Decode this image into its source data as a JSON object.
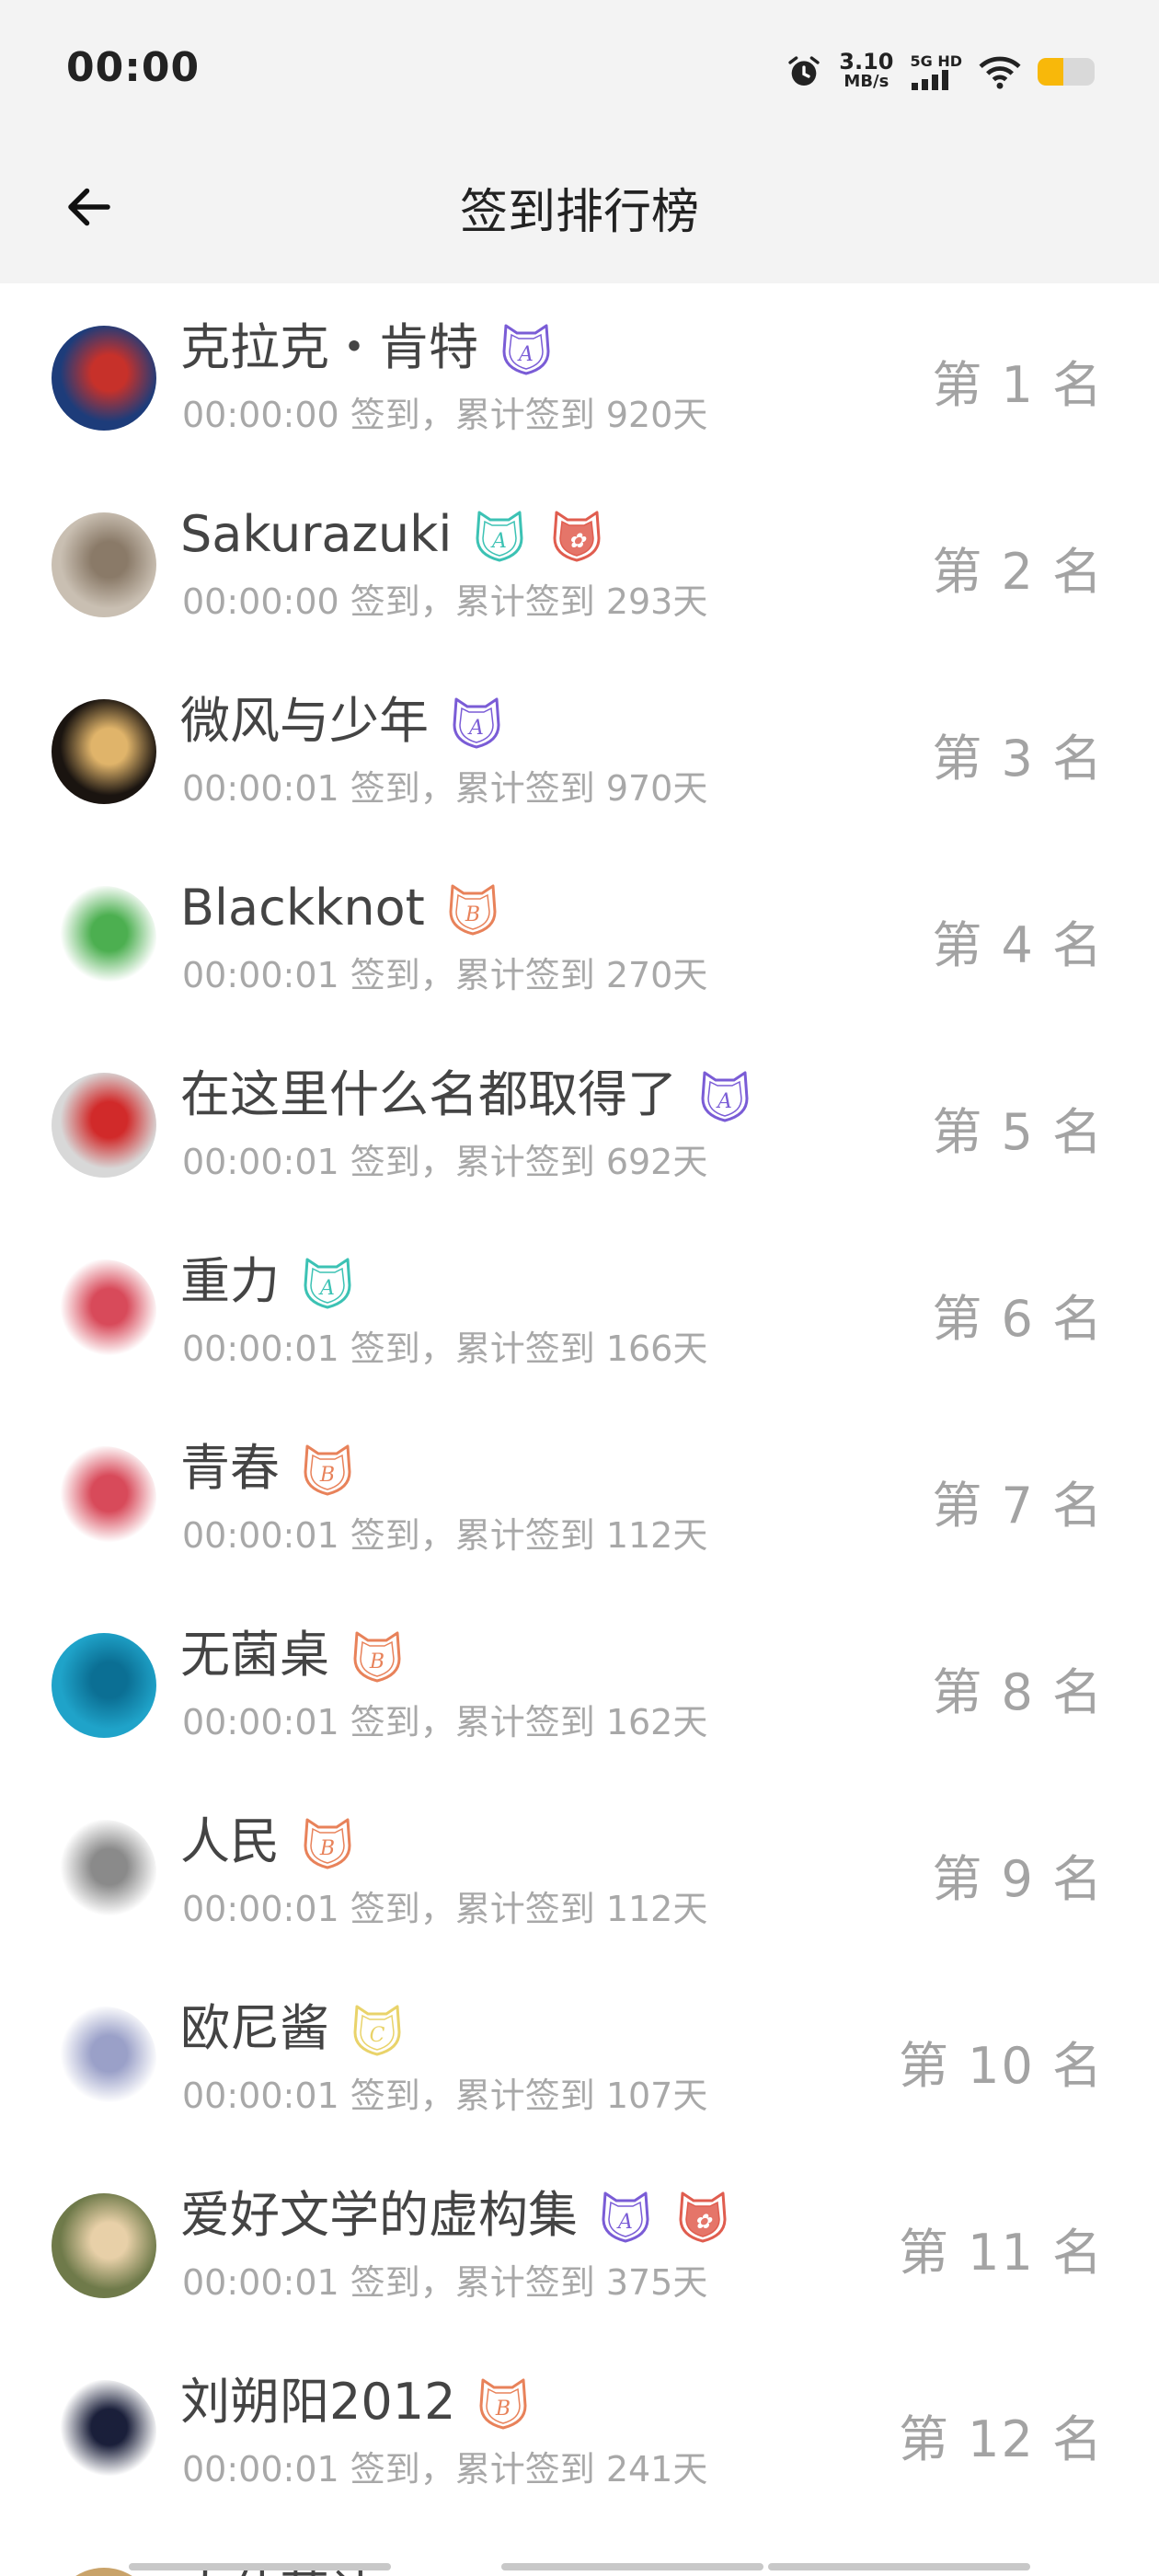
{
  "status_bar": {
    "time": "00:00",
    "speed_value": "3.10",
    "speed_unit": "MB/s",
    "network_top": "5G HD",
    "battery_level": 0.45,
    "battery_color": "#f8b80a"
  },
  "header": {
    "title": "签到排行榜"
  },
  "ranking": [
    {
      "name": "克拉克・肯特",
      "time": "00:00:00",
      "days": "920",
      "rank": "第 1 名",
      "avatar_colors": [
        "#1d3c7a",
        "#c7312a"
      ],
      "badges": [
        {
          "icon": "badge-a-purple",
          "color": "#7a5cd6",
          "letter": "A"
        }
      ]
    },
    {
      "name": "Sakurazuki",
      "time": "00:00:00",
      "days": "293",
      "rank": "第 2 名",
      "avatar_colors": [
        "#c9bfb2",
        "#8a7a68"
      ],
      "badges": [
        {
          "icon": "badge-a-teal",
          "color": "#3cc2b4",
          "letter": "A"
        },
        {
          "icon": "badge-special-red",
          "color": "#e05d4f",
          "letter": "✿"
        }
      ]
    },
    {
      "name": "微风与少年",
      "time": "00:00:01",
      "days": "970",
      "rank": "第 3 名",
      "avatar_colors": [
        "#1a1410",
        "#e0b46a"
      ],
      "badges": [
        {
          "icon": "badge-a-purple",
          "color": "#7a5cd6",
          "letter": "A"
        }
      ]
    },
    {
      "name": "Blackknot",
      "time": "00:00:01",
      "days": "270",
      "rank": "第 4 名",
      "avatar_colors": [
        "#ffffff",
        "#4caf50"
      ],
      "badges": [
        {
          "icon": "badge-b-orange",
          "color": "#e8825a",
          "letter": "B"
        }
      ]
    },
    {
      "name": "在这里什么名都取得了",
      "time": "00:00:01",
      "days": "692",
      "rank": "第 5 名",
      "avatar_colors": [
        "#d8d8d8",
        "#d12a2a"
      ],
      "badges": [
        {
          "icon": "badge-a-purple",
          "color": "#7a5cd6",
          "letter": "A"
        }
      ]
    },
    {
      "name": "重力",
      "time": "00:00:01",
      "days": "166",
      "rank": "第 6 名",
      "avatar_colors": [
        "#ffffff",
        "#d84a5a"
      ],
      "badges": [
        {
          "icon": "badge-a-teal",
          "color": "#3cc2b4",
          "letter": "A"
        }
      ]
    },
    {
      "name": "青春",
      "time": "00:00:01",
      "days": "112",
      "rank": "第 7 名",
      "avatar_colors": [
        "#ffffff",
        "#d84a5a"
      ],
      "badges": [
        {
          "icon": "badge-b-orange",
          "color": "#e8825a",
          "letter": "B"
        }
      ]
    },
    {
      "name": "无菌桌",
      "time": "00:00:01",
      "days": "162",
      "rank": "第 8 名",
      "avatar_colors": [
        "#1fa3c9",
        "#0b6f94"
      ],
      "badges": [
        {
          "icon": "badge-b-orange",
          "color": "#e8825a",
          "letter": "B"
        }
      ]
    },
    {
      "name": "人民",
      "time": "00:00:01",
      "days": "112",
      "rank": "第 9 名",
      "avatar_colors": [
        "#ffffff",
        "#8a8a8a"
      ],
      "badges": [
        {
          "icon": "badge-b-orange",
          "color": "#e8825a",
          "letter": "B"
        }
      ]
    },
    {
      "name": "欧尼酱",
      "time": "00:00:01",
      "days": "107",
      "rank": "第 10 名",
      "avatar_colors": [
        "#ffffff",
        "#9aa0c8"
      ],
      "badges": [
        {
          "icon": "badge-c-yellow",
          "color": "#e9d36a",
          "letter": "C"
        }
      ]
    },
    {
      "name": "爱好文学的虚构集",
      "time": "00:00:01",
      "days": "375",
      "rank": "第 11 名",
      "avatar_colors": [
        "#6f7a4a",
        "#e8d0a8"
      ],
      "badges": [
        {
          "icon": "badge-a-purple",
          "color": "#7a5cd6",
          "letter": "A"
        },
        {
          "icon": "badge-special-red",
          "color": "#e05d4f",
          "letter": "✿"
        }
      ]
    },
    {
      "name": "刘朔阳2012",
      "time": "00:00:01",
      "days": "241",
      "rank": "第 12 名",
      "avatar_colors": [
        "#ffffff",
        "#1a1f3a"
      ],
      "badges": [
        {
          "icon": "badge-b-orange",
          "color": "#e8825a",
          "letter": "B"
        }
      ]
    }
  ],
  "sub_template": {
    "sign_label": "签到，",
    "total_label": "累计签到",
    "day_unit": "天"
  },
  "partial_row": {
    "name": "大什莫让"
  }
}
